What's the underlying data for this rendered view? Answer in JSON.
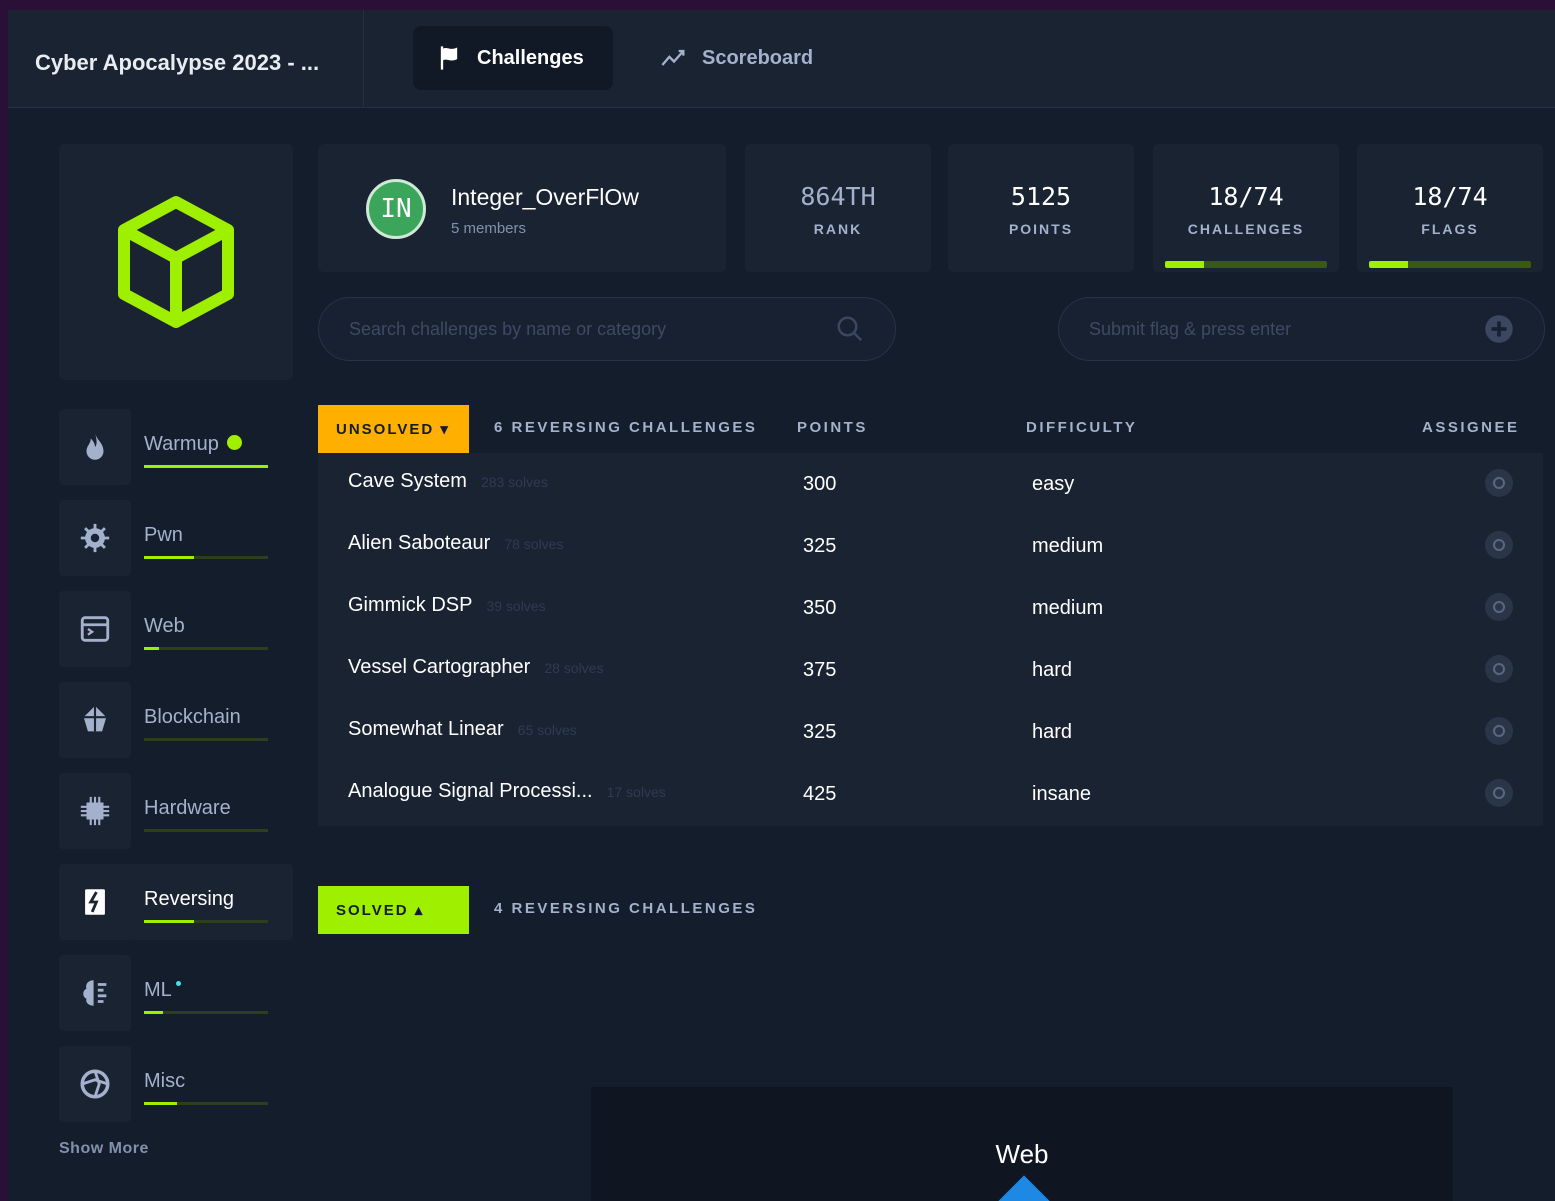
{
  "event": {
    "title": "Cyber Apocalypse 2023 - ..."
  },
  "nav": {
    "challenges": "Challenges",
    "scoreboard": "Scoreboard"
  },
  "team": {
    "initials": "IN",
    "name": "Integer_OverFlOw",
    "members": "5 members"
  },
  "stats": {
    "rank": {
      "value": "864TH",
      "label": "RANK"
    },
    "points": {
      "value": "5125",
      "label": "POINTS"
    },
    "challenges": {
      "value": "18/74",
      "label": "CHALLENGES",
      "progress": 0.243
    },
    "flags": {
      "value": "18/74",
      "label": "FLAGS",
      "progress": 0.243
    }
  },
  "search": {
    "placeholder": "Search challenges by name or category",
    "flag_placeholder": "Submit flag & press enter"
  },
  "categories": [
    {
      "label": "Warmup",
      "progress": 1.0,
      "icon": "flame-icon"
    },
    {
      "label": "Pwn",
      "progress": 0.4,
      "icon": "bug-icon"
    },
    {
      "label": "Web",
      "progress": 0.12,
      "icon": "browser-icon"
    },
    {
      "label": "Blockchain",
      "progress": 0.0,
      "icon": "blockchain-icon"
    },
    {
      "label": "Hardware",
      "progress": 0.0,
      "icon": "chip-icon"
    },
    {
      "label": "Reversing",
      "progress": 0.4,
      "icon": "reversing-icon"
    },
    {
      "label": "ML",
      "progress": 0.15,
      "icon": "brain-icon"
    },
    {
      "label": "Misc",
      "progress": 0.27,
      "icon": "aperture-icon"
    }
  ],
  "show_more": "Show More",
  "unsolved": {
    "button": "UNSOLVED ▾",
    "count": "6 REVERSING CHALLENGES",
    "columns": {
      "points": "POINTS",
      "difficulty": "DIFFICULTY",
      "assignee": "ASSIGNEE"
    },
    "rows": [
      {
        "name": "Cave System",
        "solves": "283 solves",
        "points": "300",
        "difficulty": "easy"
      },
      {
        "name": "Alien Saboteaur",
        "solves": "78 solves",
        "points": "325",
        "difficulty": "medium"
      },
      {
        "name": "Gimmick DSP",
        "solves": "39 solves",
        "points": "350",
        "difficulty": "medium"
      },
      {
        "name": "Vessel Cartographer",
        "solves": "28 solves",
        "points": "375",
        "difficulty": "hard"
      },
      {
        "name": "Somewhat Linear",
        "solves": "65 solves",
        "points": "325",
        "difficulty": "hard"
      },
      {
        "name": "Analogue Signal Processi...",
        "solves": "17 solves",
        "points": "425",
        "difficulty": "insane"
      }
    ]
  },
  "solved": {
    "button": "SOLVED ▴",
    "count": "4 REVERSING CHALLENGES"
  },
  "preview": {
    "title": "Web"
  },
  "colors": {
    "accent": "#9fef00",
    "warning": "#ffaf00",
    "background": "#141d2b",
    "card": "#1a2332"
  }
}
